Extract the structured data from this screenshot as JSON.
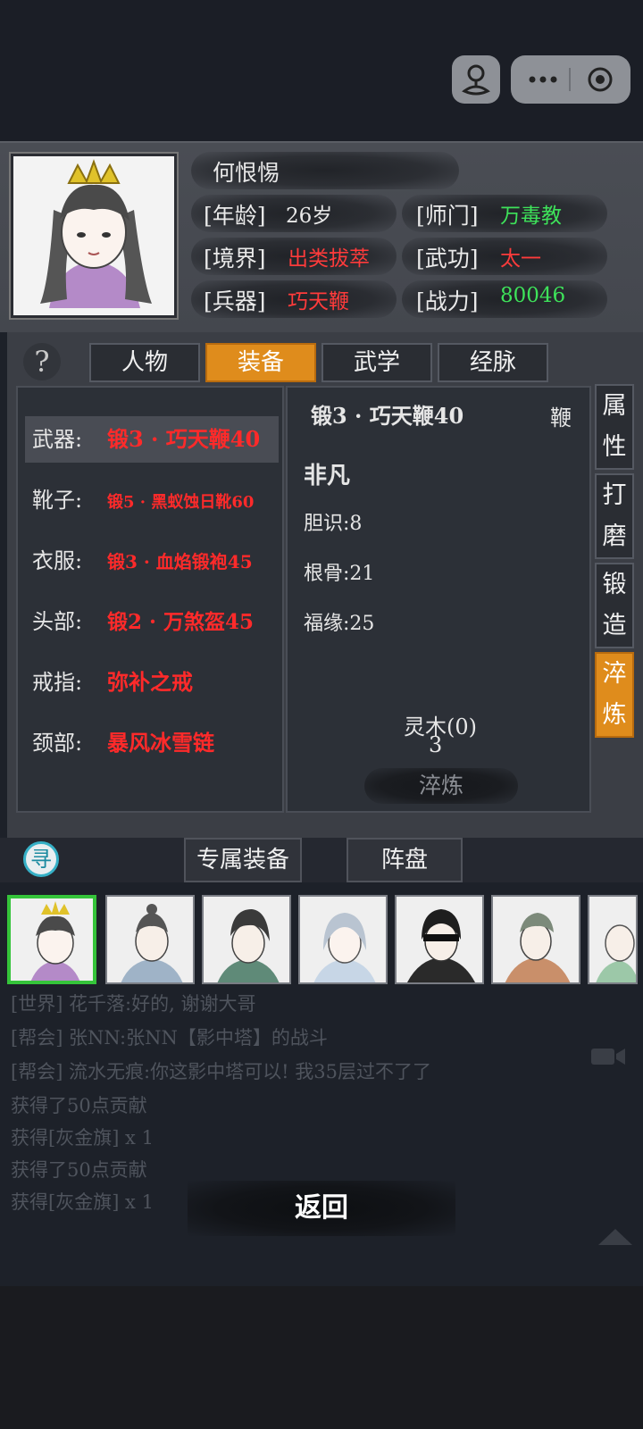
{
  "character": {
    "name": "何恨惕",
    "age_label": "[年龄]",
    "age_value": "26岁",
    "sect_label": "[师门]",
    "sect_value": "万毒教",
    "realm_label": "[境界]",
    "realm_value": "出类拔萃",
    "skill_label": "[武功]",
    "skill_value": "太一",
    "weapon_label": "[兵器]",
    "weapon_value": "巧天鞭",
    "power_label": "[战力]",
    "power_value": "80046"
  },
  "tabs": {
    "help": "?",
    "items": [
      "人物",
      "装备",
      "武学",
      "经脉"
    ],
    "active": "装备"
  },
  "equipment": [
    {
      "slot": "武器:",
      "item": "锻3 · 巧天鞭40"
    },
    {
      "slot": "靴子:",
      "item": "锻5 · 黑蚁蚀日靴60"
    },
    {
      "slot": "衣服:",
      "item": "锻3 · 血焰锻袍45"
    },
    {
      "slot": "头部:",
      "item": "锻2 · 万煞盔45"
    },
    {
      "slot": "戒指:",
      "item": "弥补之戒"
    },
    {
      "slot": "颈部:",
      "item": "暴风冰雪链"
    }
  ],
  "detail": {
    "title": "锻3 · 巧天鞭40",
    "type": "鞭",
    "grade": "非凡",
    "stats": [
      "胆识:8",
      "根骨:21",
      "福缘:25"
    ],
    "material": "灵木(0)",
    "cost": "3",
    "refine_button": "淬炼"
  },
  "side_tabs": [
    {
      "line1": "属",
      "line2": "性"
    },
    {
      "line1": "打",
      "line2": "磨"
    },
    {
      "line1": "锻",
      "line2": "造"
    },
    {
      "line1": "淬",
      "line2": "炼"
    }
  ],
  "bottom_tabs": {
    "seek": "寻",
    "exclusive": "专属装备",
    "formation": "阵盘"
  },
  "chat": [
    "[世界] 花千落:好的, 谢谢大哥",
    "[帮会] 张NN:张NN【影中塔】的战斗",
    "[帮会] 流水无痕:你这影中塔可以! 我35层过不了了",
    "获得了50点贡献",
    "获得[灰金旗] x 1",
    "获得了50点贡献",
    "获得[灰金旗] x 1"
  ],
  "back_button": "返回",
  "colors": {
    "accent_orange": "#df8c1c",
    "equip_red": "#ff2a2a",
    "power_green": "#3ee25a",
    "grade_brown": "#e9a25a"
  }
}
